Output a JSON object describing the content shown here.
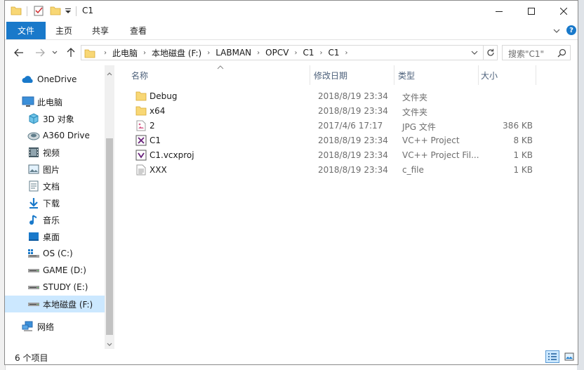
{
  "window": {
    "title": "C1"
  },
  "ribbon": {
    "tabs": [
      {
        "label": "文件"
      },
      {
        "label": "主页"
      },
      {
        "label": "共享"
      },
      {
        "label": "查看"
      }
    ]
  },
  "address": {
    "crumbs": [
      "此电脑",
      "本地磁盘 (F:)",
      "LABMAN",
      "OPCV",
      "C1",
      "C1"
    ]
  },
  "search": {
    "placeholder": "搜索\"C1\""
  },
  "nav": {
    "items": [
      {
        "label": "OneDrive",
        "icon": "cloud-icon"
      },
      {
        "label": "此电脑",
        "icon": "computer-icon"
      },
      {
        "label": "3D 对象",
        "icon": "3d-objects-icon"
      },
      {
        "label": "A360 Drive",
        "icon": "a360-icon"
      },
      {
        "label": "视频",
        "icon": "video-icon"
      },
      {
        "label": "图片",
        "icon": "pictures-icon"
      },
      {
        "label": "文档",
        "icon": "documents-icon"
      },
      {
        "label": "下载",
        "icon": "download-icon"
      },
      {
        "label": "音乐",
        "icon": "music-icon"
      },
      {
        "label": "桌面",
        "icon": "desktop-icon"
      },
      {
        "label": "OS (C:)",
        "icon": "drive-icon"
      },
      {
        "label": "GAME (D:)",
        "icon": "drive-icon"
      },
      {
        "label": "STUDY (E:)",
        "icon": "drive-icon"
      },
      {
        "label": "本地磁盘 (F:)",
        "icon": "drive-icon"
      },
      {
        "label": "网络",
        "icon": "network-icon"
      }
    ],
    "selected": "本地磁盘 (F:)"
  },
  "columns": {
    "name": "名称",
    "date": "修改日期",
    "type": "类型",
    "size": "大小"
  },
  "files": [
    {
      "name": "Debug",
      "date": "2018/8/19 23:34",
      "type": "文件夹",
      "size": "",
      "icon": "folder-icon"
    },
    {
      "name": "x64",
      "date": "2018/8/19 23:34",
      "type": "文件夹",
      "size": "",
      "icon": "folder-icon"
    },
    {
      "name": "2",
      "date": "2017/4/6 17:17",
      "type": "JPG 文件",
      "size": "386 KB",
      "icon": "image-file-icon"
    },
    {
      "name": "C1",
      "date": "2018/8/19 23:34",
      "type": "VC++ Project",
      "size": "8 KB",
      "icon": "vc-project-icon"
    },
    {
      "name": "C1.vcxproj",
      "date": "2018/8/19 23:34",
      "type": "VC++ Project Fil...",
      "size": "1 KB",
      "icon": "vcxproj-icon"
    },
    {
      "name": "XXX",
      "date": "2018/8/19 23:34",
      "type": "c_file",
      "size": "1 KB",
      "icon": "text-file-icon"
    }
  ],
  "status": {
    "count": "6 个项目"
  },
  "colors": {
    "accent": "#1979ca",
    "selected": "#cce8ff",
    "folder": "#f8d775"
  }
}
